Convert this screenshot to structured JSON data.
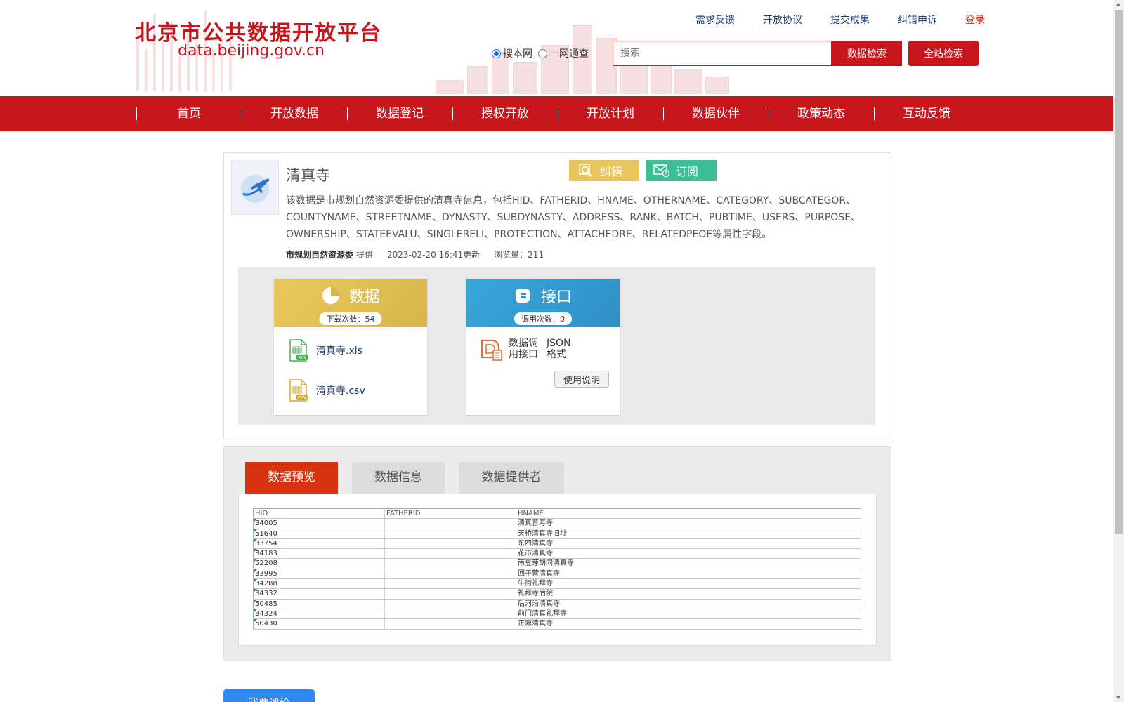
{
  "header": {
    "logo_cn": "北京市公共数据开放平台",
    "logo_en": "data.beijing.gov.cn",
    "links": [
      "需求反馈",
      "开放协议",
      "提交成果",
      "纠错申诉"
    ],
    "login": "登录",
    "scope_options": [
      "搜本网",
      "一网通查"
    ],
    "scope_selected": "搜本网",
    "search_placeholder": "搜索",
    "search_button": "数据检索",
    "site_search_button": "全站检索"
  },
  "nav": [
    "首页",
    "开放数据",
    "数据登记",
    "授权开放",
    "开放计划",
    "数据伙伴",
    "政策动态",
    "互动反馈"
  ],
  "dataset": {
    "title": "清真寺",
    "correct_button": "纠错",
    "subscribe_button": "订阅",
    "description": "该数据是市规划自然资源委提供的清真寺信息，包括HID、FATHERID、HNAME、OTHERNAME、CATEGORY、SUBCATEGOR、COUNTYNAME、STREETNAME、DYNASTY、SUBDYNASTY、ADDRESS、RANK、BATCH、PUBTIME、USERS、PURPOSE、OWNERSHIP、STATEEVALU、SINGLERELI、PROTECTION、ATTACHEDRE、RELATEDPEOE等属性字段。",
    "provider": "市规划自然资源委",
    "provider_suffix": "提供",
    "updated": "2023-02-20 16:41更新",
    "views": "浏览量：211"
  },
  "data_box": {
    "title": "数据",
    "count": "下载次数：54",
    "files": [
      "清真寺.xls",
      "清真寺.csv"
    ]
  },
  "api_box": {
    "title": "接口",
    "count": "调用次数：0",
    "label_col1": "数据调用接口",
    "label_col2": "JSON格式",
    "help_button": "使用说明"
  },
  "tabs": [
    "数据预览",
    "数据信息",
    "数据提供者"
  ],
  "preview": {
    "columns": [
      "HID",
      "FATHERID",
      "HNAME"
    ],
    "rows": [
      [
        "34005",
        "",
        "清真普寿寺"
      ],
      [
        "51640",
        "",
        "天桥清真寺旧址"
      ],
      [
        "33754",
        "",
        "东四清真寺"
      ],
      [
        "34183",
        "",
        "花市清真寺"
      ],
      [
        "52208",
        "",
        "南豆芽胡同清真寺"
      ],
      [
        "33995",
        "",
        "回子营清真寺"
      ],
      [
        "34288",
        "",
        "牛街礼拜寺"
      ],
      [
        "34332",
        "",
        "礼拜寺后院"
      ],
      [
        "50485",
        "",
        "后河沿清真寺"
      ],
      [
        "34324",
        "",
        "前门清真礼拜寺"
      ],
      [
        "50430",
        "",
        "正源清真寺"
      ]
    ]
  },
  "rate_button": "我要评价",
  "colors": {
    "brand_red": "#c8161d",
    "tab_active": "#d8330f",
    "correct": "#e7c660",
    "subscribe": "#3bbd96",
    "link_blue": "#1d3b70"
  }
}
